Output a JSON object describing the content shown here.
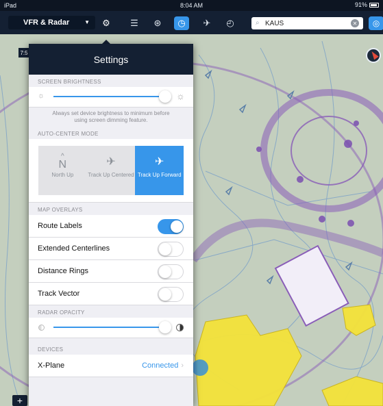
{
  "status_bar": {
    "device": "iPad",
    "time": "8:04 AM",
    "battery": "91%"
  },
  "toolbar": {
    "layer_label": "VFR & Radar",
    "search_value": "KAUS"
  },
  "map": {
    "side_tab_label": "7:5",
    "zoom_label": "+"
  },
  "settings": {
    "title": "Settings",
    "screen_brightness": {
      "header": "SCREEN BRIGHTNESS",
      "level": 0.92,
      "note": "Always set device brightness to minimum before using screen dimming feature."
    },
    "auto_center": {
      "header": "AUTO-CENTER MODE",
      "north_up_glyph": "N",
      "options": [
        "North Up",
        "Track Up Centered",
        "Track Up Forward"
      ],
      "selected": "Track Up Forward"
    },
    "map_overlays": {
      "header": "MAP OVERLAYS",
      "items": [
        {
          "label": "Route Labels",
          "on": true
        },
        {
          "label": "Extended Centerlines",
          "on": false
        },
        {
          "label": "Distance Rings",
          "on": false
        },
        {
          "label": "Track Vector",
          "on": false
        }
      ]
    },
    "radar_opacity": {
      "header": "RADAR OPACITY",
      "level": 0.92
    },
    "devices": {
      "header": "DEVICES",
      "items": [
        {
          "name": "X-Plane",
          "status": "Connected"
        }
      ]
    }
  },
  "colors": {
    "accent": "#3796ea",
    "toolbar": "#142033",
    "airspace": "#8a5db8",
    "urban": "#f4e33a"
  }
}
